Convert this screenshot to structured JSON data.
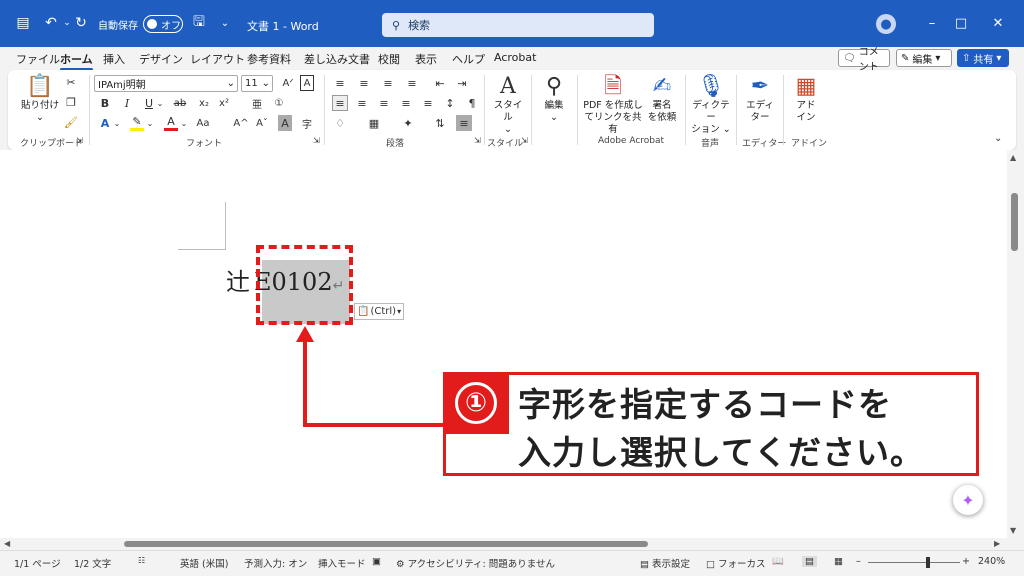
{
  "titlebar": {
    "autosave_label": "自動保存",
    "autosave_state": "オフ",
    "doc_title": "文書 1  -  Word",
    "search_placeholder": "検索"
  },
  "tabs": [
    "ファイル",
    "ホーム",
    "挿入",
    "デザイン",
    "レイアウト",
    "参考資料",
    "差し込み文書",
    "校閲",
    "表示",
    "ヘルプ",
    "Acrobat"
  ],
  "active_tab": "ホーム",
  "top_buttons": {
    "comment": "コメント",
    "edit": "編集",
    "share": "共有"
  },
  "ribbon": {
    "clipboard": {
      "paste": "貼り付け",
      "group": "クリップボード"
    },
    "font": {
      "name": "IPAmj明朝",
      "size": "11",
      "group": "フォント"
    },
    "paragraph": {
      "group": "段落"
    },
    "style": {
      "label": "スタイル",
      "group": "スタイル"
    },
    "edit": {
      "label": "編集"
    },
    "acrobat": {
      "pdf_line1": "PDF を作成し",
      "pdf_line2": "てリンクを共有",
      "sign_line1": "署名",
      "sign_line2": "を依頼",
      "group": "Adobe Acrobat"
    },
    "voice": {
      "line1": "ディクテー",
      "line2": "ション",
      "group": "音声"
    },
    "editor": {
      "line1": "エディ",
      "line2": "ター",
      "group": "エディター"
    },
    "addin": {
      "line1": "アド",
      "line2": "イン",
      "group": "アドイン"
    }
  },
  "document": {
    "prefix_char": "辻",
    "selected_code": "E0102",
    "paste_options": "(Ctrl)"
  },
  "callout": {
    "number": "①",
    "line1": "字形を指定するコードを",
    "line2": "入力し選択してください。"
  },
  "statusbar": {
    "page": "1/1 ページ",
    "words": "1/2 文字",
    "language": "英語 (米国)",
    "predict": "予測入力: オン",
    "insert_mode": "挿入モード",
    "accessibility": "アクセシビリティ: 問題ありません",
    "display_settings": "表示設定",
    "focus": "フォーカス",
    "zoom": "240%"
  },
  "colors": {
    "accent": "#1f5ec0",
    "callout_red": "#e21b1b"
  }
}
